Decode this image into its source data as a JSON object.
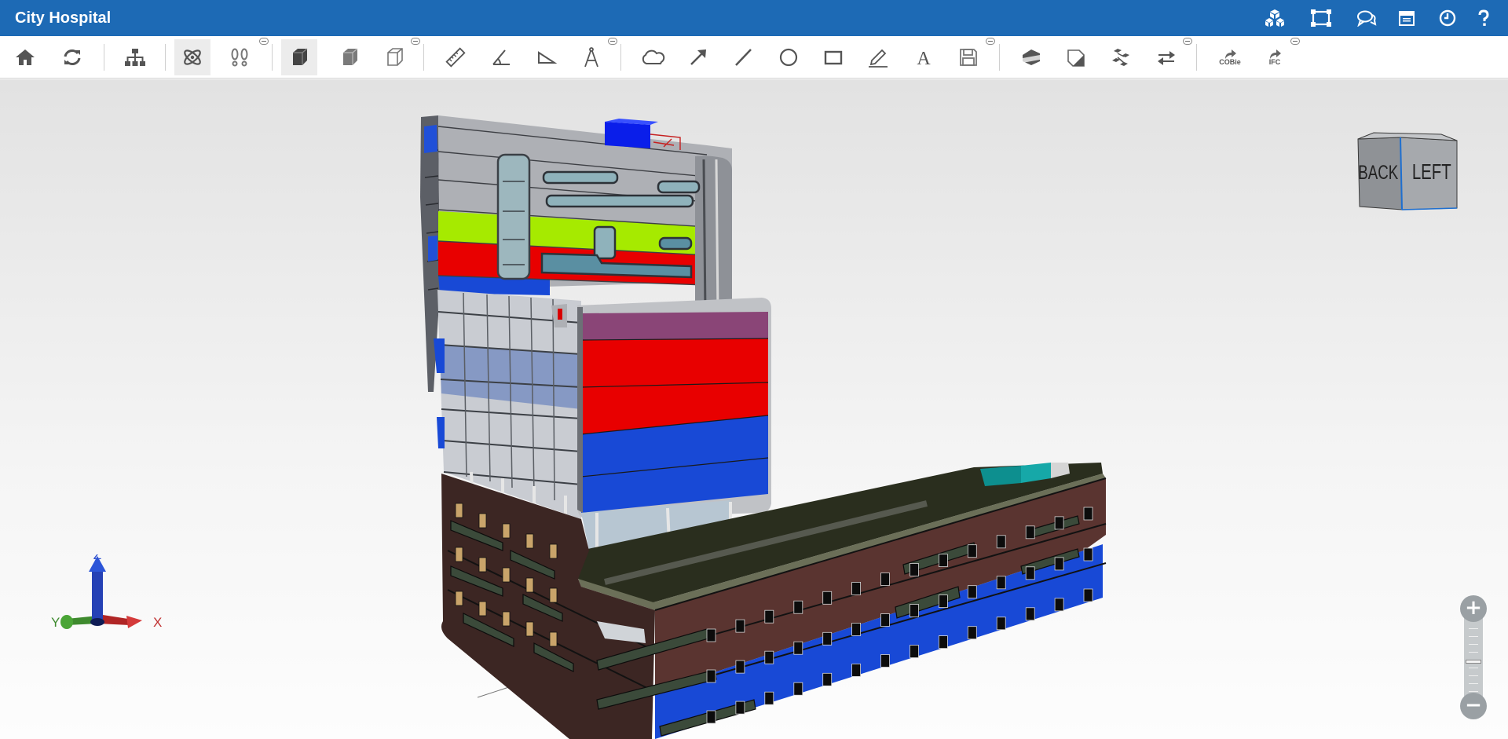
{
  "app": {
    "title": "City Hospital"
  },
  "header_icons": [
    {
      "name": "models-icon"
    },
    {
      "name": "views-icon"
    },
    {
      "name": "comments-icon"
    },
    {
      "name": "calendar-icon"
    },
    {
      "name": "history-icon"
    },
    {
      "name": "help-icon"
    }
  ],
  "toolbar": {
    "cobie_label": "COBie",
    "ifc_label": "IFC"
  },
  "viewcube": {
    "back": "BACK",
    "left": "LEFT"
  },
  "axis": {
    "x": "X",
    "y": "Y",
    "z": "Z"
  },
  "zoom": {
    "in": "+",
    "out": "−",
    "level": 0.48
  },
  "colors": {
    "header": "#1d6ab5",
    "lime": "#a6ea00",
    "red": "#e80000",
    "blue": "#1849d6",
    "purple": "#8a4577",
    "brick": "#5a3430"
  }
}
